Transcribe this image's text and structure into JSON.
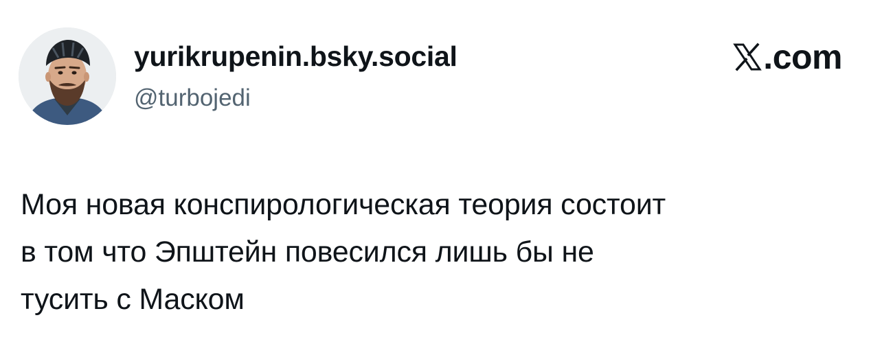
{
  "author": {
    "display_name": "yurikrupenin.bsky.social",
    "handle": "@turbojedi",
    "avatar_icon": "profile-photo-man-with-helmet-icon"
  },
  "brand": {
    "logo_icon": "x-logo-icon",
    "domain": ".com"
  },
  "tweet": {
    "text": "Моя новая конспирологическая теория состоит\nв том что Эпштейн повесился лишь бы не\nтусить с Маском"
  },
  "colors": {
    "text_primary": "#0f1419",
    "text_secondary": "#536471",
    "background": "#ffffff"
  }
}
